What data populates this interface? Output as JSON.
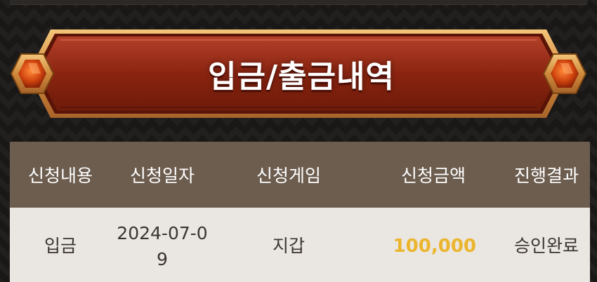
{
  "banner": {
    "title": "입금/출금내역"
  },
  "table": {
    "headers": [
      "신청내용",
      "신청일자",
      "신청게임",
      "신청금액",
      "진행결과"
    ],
    "rows": [
      {
        "type": "입금",
        "date": "2024-07-09",
        "game": "지갑",
        "amount": "100,000",
        "result": "승인완료"
      }
    ]
  },
  "colors": {
    "banner_red": "#8a2410",
    "banner_gold": "#e0a64a",
    "header_bg": "#6c5d4f",
    "row_bg": "#eae6e1",
    "amount": "#ecb52e"
  }
}
